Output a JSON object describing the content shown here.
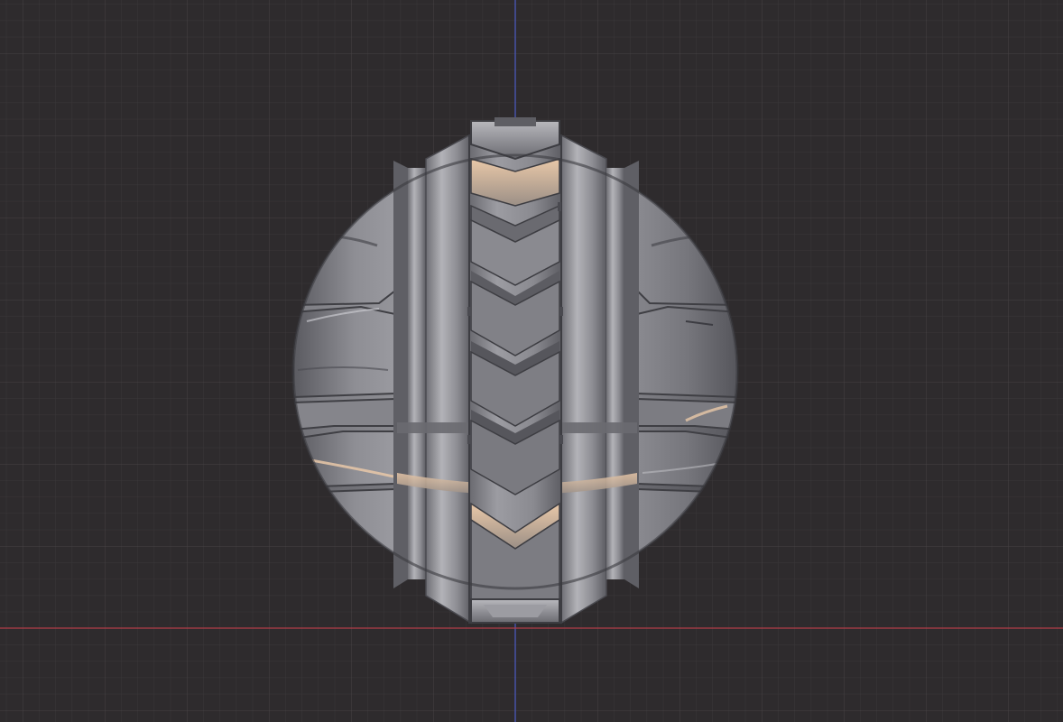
{
  "viewport": {
    "background_color": "#2e2b2d",
    "grid_minor_color": "#3a3739",
    "grid_major_color": "#474345",
    "x_axis_color": "#b33c4a",
    "y_axis_color": "#4c5bc4",
    "axes_shown": [
      "x-axis",
      "y-axis"
    ]
  },
  "object": {
    "kind": "sculpted-sphere",
    "material_color": "#8a8a8f",
    "highlight_color": "#e8c7a6",
    "features": [
      "central-chevron-spine",
      "left-armor-panels",
      "right-armor-panels",
      "vertical-rib-bands"
    ]
  }
}
